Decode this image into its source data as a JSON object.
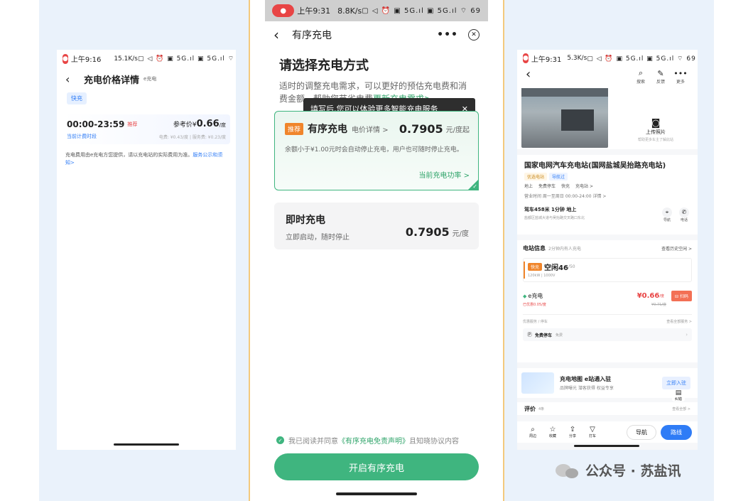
{
  "left": {
    "status": {
      "time": "上午9:16",
      "speed": "15.1K/s",
      "icons": "▢ ◁ ⏰ ▣ 5G.ıl ▣ 5G.ıl ⌔ ▭"
    },
    "title": "充电价格详情",
    "brand": "e充电",
    "tag": "快充",
    "period": "00:00-23:59",
    "period_tag": "推荐",
    "ref_label": "参考价¥",
    "ref_price": "0.66",
    "ref_unit": "/度",
    "current_period": "当前计费时段",
    "fee_detail": "电费: ¥0.43/度 | 服务费: ¥0.23/度",
    "note": "充电费用由e充电方您提供，请以充电站的实际费用为准。",
    "note_link": "服务公示和须知>"
  },
  "middle": {
    "status": {
      "time": "上午9:31",
      "speed": "8.8K/s",
      "icons": "▢ ◁ ⏰ ▣ 5G.ıl ▣ 5G.ıl ⌔ 69"
    },
    "nav_title": "有序充电",
    "heading": "请选择充电方式",
    "desc_a": "适时的调整充电需求，可以更好的预估充电费和消费金额，帮助您节省电费",
    "desc_link": "更新充电需求>",
    "tooltip": "填写后,您可以体验更多智能充电服务",
    "tooltip_close": "✕",
    "card1": {
      "badge": "推荐",
      "title": "有序充电",
      "link": "电价详情 >",
      "price": "0.7905",
      "unit": "元/度起",
      "desc": "余额小于¥1.00元时会自动停止充电，用户也可随时停止充电。",
      "power": "当前充电功率 >"
    },
    "card2": {
      "title": "即时充电",
      "sub": "立即启动，随时停止",
      "price": "0.7905",
      "unit": "元/度"
    },
    "agree_a": "我已阅读并同意",
    "agree_link": "《有序充电免责声明》",
    "agree_b": "且知晓协议内容",
    "cta": "开启有序充电"
  },
  "right": {
    "status": {
      "time": "上午9:31",
      "speed": "5.3K/s",
      "icons": "▢ ◁ ⏰ ▣ 5G.ıl ▣ 5G.ıl ⌔ 69"
    },
    "actions": [
      "搜索",
      "反馈",
      "更多"
    ],
    "upload": "上传照片",
    "upload_sub": "帮助更多车主了解此站",
    "station_name": "国家电网汽车充电站(国网盐城吴抬路充电站)",
    "station_tags": [
      "优选电站",
      "导航过"
    ],
    "station_feats": [
      "地上",
      "免费停车",
      "快充",
      "充电站 >"
    ],
    "hours": "营业时间 周一至周日 00:00-24:00 详情 >",
    "distance": "驾车458米 1分钟 地上",
    "address": "盐都区盐城大道与吴抬路交叉路口东北",
    "nav_btns": [
      "导航",
      "电话"
    ],
    "info_title": "电站信息",
    "info_sub": "2分钟内有人充电",
    "history": "查看历史空闲 >",
    "fast_tag": "快充",
    "free_count": "空闲46",
    "total_count": "/50",
    "spec": "120kW  | 1000V",
    "operator": "e充电",
    "price": "¥0.66",
    "price_unit": "/度",
    "orig_price": "¥0.71/度",
    "discount": "已优惠0.05/度",
    "scan": "扫码",
    "service_label": "优惠服务 / 停车",
    "service_more": "查看全部服务 >",
    "parking": "免费停车",
    "parking_sub": "免费",
    "banner_title": "充电地图 e站通入驻",
    "banner_sub": "品牌曝光 潜客获得 权益专享",
    "banner_btn": "立即入驻",
    "side_label": "纠错",
    "review": "评价",
    "review_sub": "4条",
    "review_more": "查看全部 >",
    "bottom": [
      "周边",
      "收藏",
      "分享",
      "打车"
    ],
    "go_btn": "导航",
    "route_btn": "路线"
  },
  "watermark": "公众号 · 苏盐讯",
  "colors": {
    "green": "#3fb57f",
    "light_green": "#eaf6ef",
    "red": "#e84545",
    "blue": "#2f7cf6",
    "orange": "#f0852b"
  }
}
